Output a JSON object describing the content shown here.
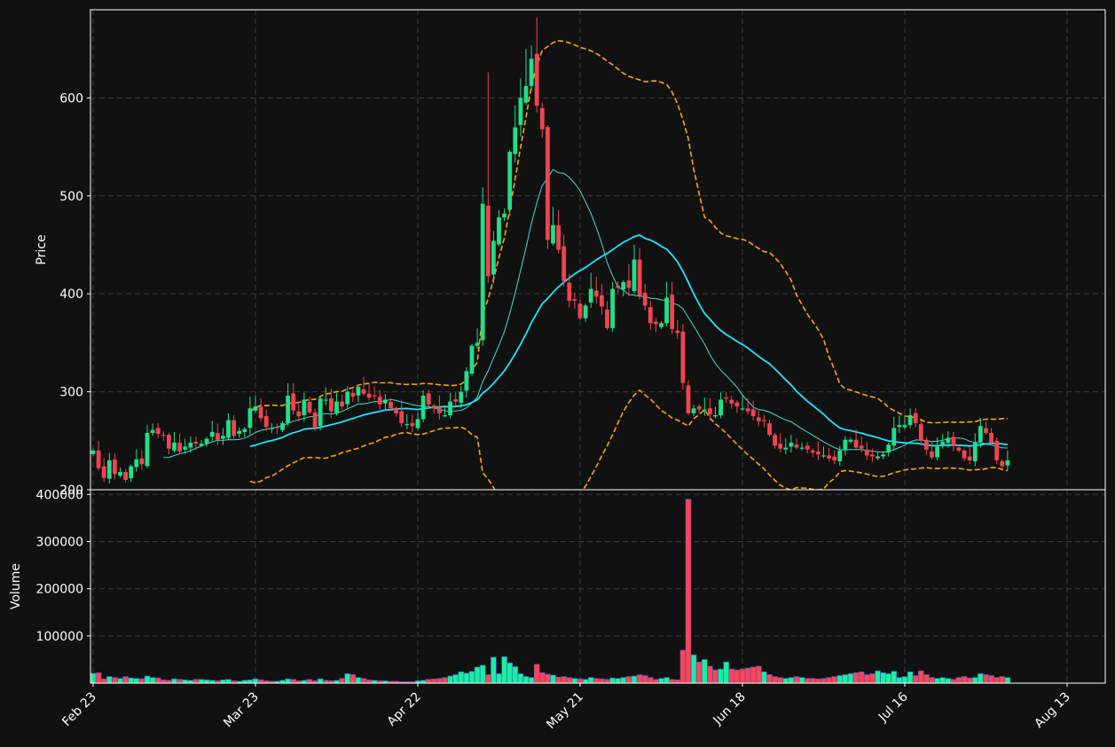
{
  "chart_data": {
    "type": "candlestick",
    "title": "",
    "panels": {
      "price": {
        "ylabel": "Price",
        "ylim": [
          200,
          690
        ],
        "yticks": [
          200,
          300,
          400,
          500,
          600
        ]
      },
      "volume": {
        "ylabel": "Volume",
        "ylim": [
          0,
          410000
        ],
        "yticks": [
          100000,
          200000,
          300000,
          400000
        ]
      }
    },
    "grid": true,
    "x_start_date": "2024-02-23",
    "xtick_labels": [
      "Feb 23",
      "Mar 23",
      "Apr 22",
      "May 21",
      "Jun 18",
      "Jul 16",
      "Aug 13"
    ],
    "xtick_indices": [
      0,
      30,
      60,
      90,
      120,
      150,
      180
    ],
    "series": [
      {
        "name": "Close",
        "style": "candlestick"
      },
      {
        "name": "MA fast",
        "style": "line"
      },
      {
        "name": "MA slow",
        "style": "line"
      },
      {
        "name": "Upper band",
        "style": "dashed"
      },
      {
        "name": "Lower band",
        "style": "dashed"
      }
    ],
    "close": [
      240,
      222,
      212,
      230,
      216,
      218,
      210,
      224,
      231,
      226,
      258,
      261,
      257,
      255,
      242,
      248,
      239,
      244,
      248,
      247,
      247,
      252,
      259,
      251,
      255,
      271,
      255,
      260,
      262,
      283,
      285,
      273,
      264,
      263,
      263,
      268,
      296,
      281,
      275,
      292,
      279,
      263,
      293,
      292,
      280,
      290,
      285,
      300,
      295,
      305,
      298,
      294,
      296,
      287,
      292,
      283,
      278,
      268,
      267,
      265,
      272,
      296,
      287,
      283,
      278,
      276,
      290,
      290,
      300,
      321,
      347,
      350,
      492,
      418,
      454,
      478,
      482,
      545,
      570,
      600,
      612,
      640,
      592,
      568,
      455,
      470,
      445,
      413,
      393,
      393,
      375,
      388,
      405,
      397,
      387,
      365,
      405,
      406,
      412,
      406,
      435,
      398,
      388,
      370,
      369,
      370,
      396,
      364,
      360,
      309,
      278,
      283,
      282,
      282,
      277,
      276,
      292,
      293,
      288,
      285,
      283,
      280,
      275,
      270,
      270,
      256,
      245,
      242,
      243,
      248,
      243,
      243,
      241,
      238,
      236,
      235,
      232,
      230,
      240,
      251,
      251,
      243,
      242,
      235,
      234,
      234,
      236,
      246,
      263,
      266,
      266,
      276,
      268,
      250,
      241,
      233,
      244,
      249,
      253,
      245,
      240,
      232,
      230,
      248,
      265,
      258,
      248,
      230,
      224,
      230
    ],
    "volume": [
      21000,
      22000,
      9000,
      14000,
      12000,
      10000,
      14000,
      11000,
      10000,
      9000,
      15000,
      12000,
      11000,
      7000,
      6000,
      9000,
      8000,
      7000,
      6000,
      8000,
      8000,
      7000,
      6000,
      5000,
      7000,
      8000,
      5000,
      4000,
      6000,
      7000,
      9000,
      7000,
      5000,
      4000,
      4000,
      6000,
      9000,
      8000,
      5000,
      6000,
      8000,
      5000,
      9000,
      6000,
      5000,
      6000,
      10000,
      20000,
      18000,
      12000,
      10000,
      7000,
      6000,
      5000,
      5000,
      4000,
      4000,
      3000,
      3000,
      3000,
      5000,
      6000,
      8000,
      9000,
      10000,
      12000,
      15000,
      18000,
      24000,
      21000,
      25000,
      34000,
      38000,
      18000,
      55000,
      20000,
      56000,
      43000,
      35000,
      20000,
      14000,
      12000,
      40000,
      22000,
      19000,
      17000,
      13000,
      14000,
      12000,
      10000,
      9000,
      8000,
      12000,
      10000,
      9000,
      8000,
      11000,
      10000,
      12000,
      14000,
      15000,
      18000,
      16000,
      12000,
      8000,
      10000,
      12000,
      8000,
      7000,
      70000,
      390000,
      60000,
      45000,
      50000,
      36000,
      28000,
      30000,
      45000,
      30000,
      28000,
      30000,
      32000,
      34000,
      36000,
      24000,
      18000,
      14000,
      12000,
      10000,
      12000,
      14000,
      12000,
      10000,
      10000,
      9000,
      10000,
      12000,
      14000,
      16000,
      18000,
      20000,
      22000,
      24000,
      18000,
      20000,
      26000,
      22000,
      20000,
      25000,
      12000,
      14000,
      24000,
      16000,
      26000,
      18000,
      12000,
      10000,
      12000,
      10000,
      8000,
      12000,
      14000,
      11000,
      12000,
      20000,
      18000,
      16000,
      12000,
      14000,
      12000
    ]
  }
}
